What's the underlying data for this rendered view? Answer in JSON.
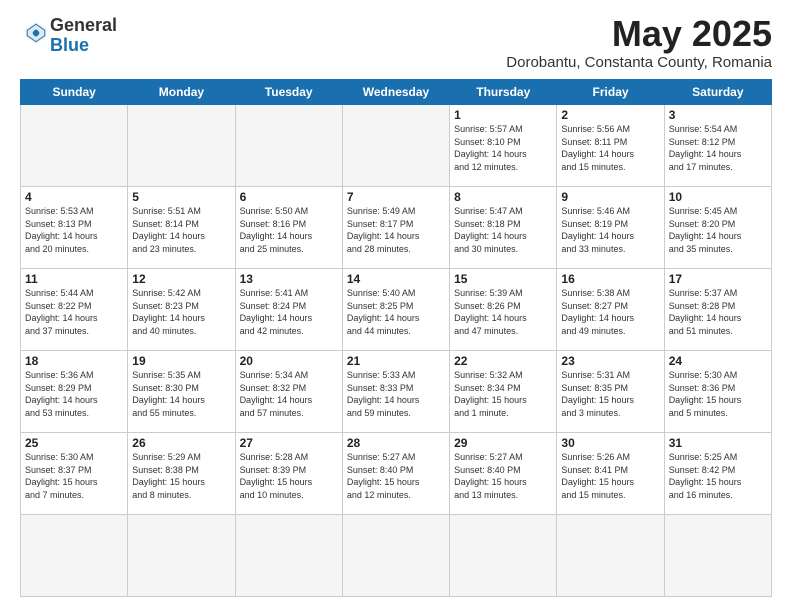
{
  "logo": {
    "general": "General",
    "blue": "Blue"
  },
  "header": {
    "month": "May 2025",
    "location": "Dorobantu, Constanta County, Romania"
  },
  "weekdays": [
    "Sunday",
    "Monday",
    "Tuesday",
    "Wednesday",
    "Thursday",
    "Friday",
    "Saturday"
  ],
  "days": [
    {
      "num": "",
      "info": ""
    },
    {
      "num": "",
      "info": ""
    },
    {
      "num": "",
      "info": ""
    },
    {
      "num": "",
      "info": ""
    },
    {
      "num": "1",
      "info": "Sunrise: 5:57 AM\nSunset: 8:10 PM\nDaylight: 14 hours\nand 12 minutes."
    },
    {
      "num": "2",
      "info": "Sunrise: 5:56 AM\nSunset: 8:11 PM\nDaylight: 14 hours\nand 15 minutes."
    },
    {
      "num": "3",
      "info": "Sunrise: 5:54 AM\nSunset: 8:12 PM\nDaylight: 14 hours\nand 17 minutes."
    },
    {
      "num": "4",
      "info": "Sunrise: 5:53 AM\nSunset: 8:13 PM\nDaylight: 14 hours\nand 20 minutes."
    },
    {
      "num": "5",
      "info": "Sunrise: 5:51 AM\nSunset: 8:14 PM\nDaylight: 14 hours\nand 23 minutes."
    },
    {
      "num": "6",
      "info": "Sunrise: 5:50 AM\nSunset: 8:16 PM\nDaylight: 14 hours\nand 25 minutes."
    },
    {
      "num": "7",
      "info": "Sunrise: 5:49 AM\nSunset: 8:17 PM\nDaylight: 14 hours\nand 28 minutes."
    },
    {
      "num": "8",
      "info": "Sunrise: 5:47 AM\nSunset: 8:18 PM\nDaylight: 14 hours\nand 30 minutes."
    },
    {
      "num": "9",
      "info": "Sunrise: 5:46 AM\nSunset: 8:19 PM\nDaylight: 14 hours\nand 33 minutes."
    },
    {
      "num": "10",
      "info": "Sunrise: 5:45 AM\nSunset: 8:20 PM\nDaylight: 14 hours\nand 35 minutes."
    },
    {
      "num": "11",
      "info": "Sunrise: 5:44 AM\nSunset: 8:22 PM\nDaylight: 14 hours\nand 37 minutes."
    },
    {
      "num": "12",
      "info": "Sunrise: 5:42 AM\nSunset: 8:23 PM\nDaylight: 14 hours\nand 40 minutes."
    },
    {
      "num": "13",
      "info": "Sunrise: 5:41 AM\nSunset: 8:24 PM\nDaylight: 14 hours\nand 42 minutes."
    },
    {
      "num": "14",
      "info": "Sunrise: 5:40 AM\nSunset: 8:25 PM\nDaylight: 14 hours\nand 44 minutes."
    },
    {
      "num": "15",
      "info": "Sunrise: 5:39 AM\nSunset: 8:26 PM\nDaylight: 14 hours\nand 47 minutes."
    },
    {
      "num": "16",
      "info": "Sunrise: 5:38 AM\nSunset: 8:27 PM\nDaylight: 14 hours\nand 49 minutes."
    },
    {
      "num": "17",
      "info": "Sunrise: 5:37 AM\nSunset: 8:28 PM\nDaylight: 14 hours\nand 51 minutes."
    },
    {
      "num": "18",
      "info": "Sunrise: 5:36 AM\nSunset: 8:29 PM\nDaylight: 14 hours\nand 53 minutes."
    },
    {
      "num": "19",
      "info": "Sunrise: 5:35 AM\nSunset: 8:30 PM\nDaylight: 14 hours\nand 55 minutes."
    },
    {
      "num": "20",
      "info": "Sunrise: 5:34 AM\nSunset: 8:32 PM\nDaylight: 14 hours\nand 57 minutes."
    },
    {
      "num": "21",
      "info": "Sunrise: 5:33 AM\nSunset: 8:33 PM\nDaylight: 14 hours\nand 59 minutes."
    },
    {
      "num": "22",
      "info": "Sunrise: 5:32 AM\nSunset: 8:34 PM\nDaylight: 15 hours\nand 1 minute."
    },
    {
      "num": "23",
      "info": "Sunrise: 5:31 AM\nSunset: 8:35 PM\nDaylight: 15 hours\nand 3 minutes."
    },
    {
      "num": "24",
      "info": "Sunrise: 5:30 AM\nSunset: 8:36 PM\nDaylight: 15 hours\nand 5 minutes."
    },
    {
      "num": "25",
      "info": "Sunrise: 5:30 AM\nSunset: 8:37 PM\nDaylight: 15 hours\nand 7 minutes."
    },
    {
      "num": "26",
      "info": "Sunrise: 5:29 AM\nSunset: 8:38 PM\nDaylight: 15 hours\nand 8 minutes."
    },
    {
      "num": "27",
      "info": "Sunrise: 5:28 AM\nSunset: 8:39 PM\nDaylight: 15 hours\nand 10 minutes."
    },
    {
      "num": "28",
      "info": "Sunrise: 5:27 AM\nSunset: 8:40 PM\nDaylight: 15 hours\nand 12 minutes."
    },
    {
      "num": "29",
      "info": "Sunrise: 5:27 AM\nSunset: 8:40 PM\nDaylight: 15 hours\nand 13 minutes."
    },
    {
      "num": "30",
      "info": "Sunrise: 5:26 AM\nSunset: 8:41 PM\nDaylight: 15 hours\nand 15 minutes."
    },
    {
      "num": "31",
      "info": "Sunrise: 5:25 AM\nSunset: 8:42 PM\nDaylight: 15 hours\nand 16 minutes."
    },
    {
      "num": "",
      "info": ""
    },
    {
      "num": "",
      "info": ""
    },
    {
      "num": "",
      "info": ""
    },
    {
      "num": "",
      "info": ""
    },
    {
      "num": "",
      "info": ""
    },
    {
      "num": "",
      "info": ""
    },
    {
      "num": "",
      "info": ""
    }
  ]
}
